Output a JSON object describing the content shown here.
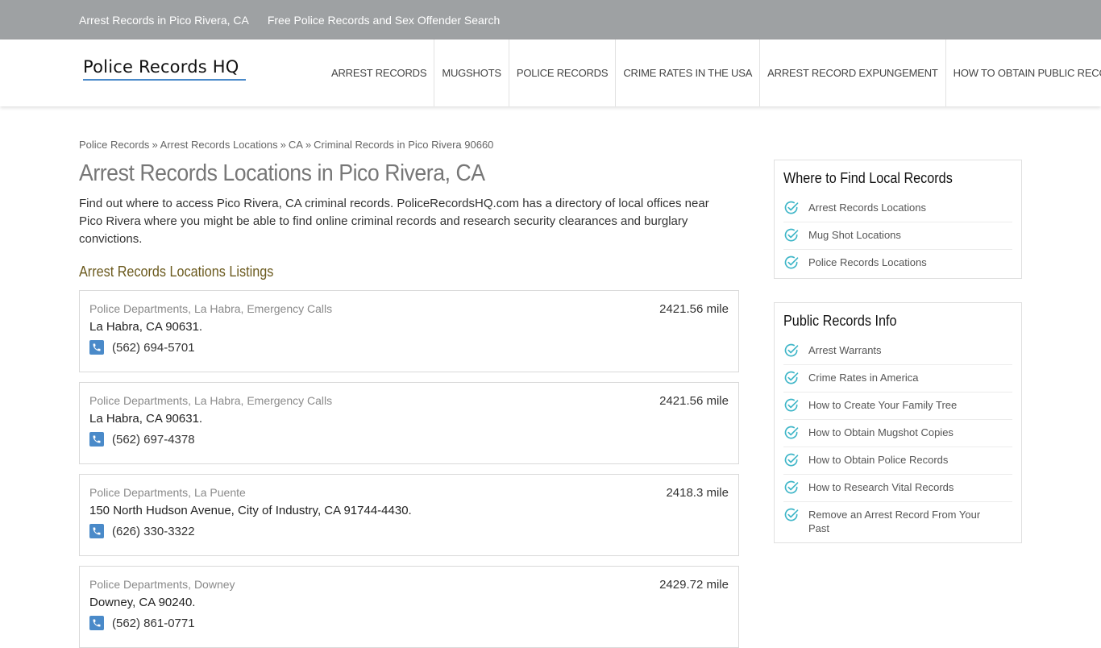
{
  "topbar": {
    "links": [
      "Arrest Records in Pico Rivera, CA",
      "Free Police Records and Sex Offender Search"
    ]
  },
  "header": {
    "logo": "Police Records HQ",
    "nav": [
      "Arrest Records",
      "Mugshots",
      "Police Records",
      "Crime Rates in the USA",
      "Arrest Record Expungement",
      "How to Obtain Public Records"
    ]
  },
  "breadcrumb": {
    "items": [
      "Police Records",
      "Arrest Records Locations",
      "CA",
      "Criminal Records in Pico Rivera 90660"
    ],
    "separator": "»"
  },
  "main": {
    "title": "Arrest Records Locations in Pico Rivera, CA",
    "intro": "Find out where to access Pico Rivera, CA criminal records. PoliceRecordsHQ.com has a directory of local offices near Pico Rivera where you might be able to find online criminal records and research security clearances and burglary convictions.",
    "listings_heading": "Arrest Records Locations Listings",
    "listings": [
      {
        "title": "Police Departments, La Habra, Emergency Calls",
        "distance": "2421.56 mile",
        "address": "La Habra, CA 90631.",
        "phone": "(562) 694-5701"
      },
      {
        "title": "Police Departments, La Habra, Emergency Calls",
        "distance": "2421.56 mile",
        "address": "La Habra, CA 90631.",
        "phone": "(562) 697-4378"
      },
      {
        "title": "Police Departments, La Puente",
        "distance": "2418.3 mile",
        "address": "150 North Hudson Avenue, City of Industry, CA 91744-4430.",
        "phone": "(626) 330-3322"
      },
      {
        "title": "Police Departments, Downey",
        "distance": "2429.72 mile",
        "address": "Downey, CA 90240.",
        "phone": "(562) 861-0771"
      }
    ]
  },
  "sidebar": {
    "widgets": [
      {
        "title": "Where to Find Local Records",
        "items": [
          "Arrest Records Locations",
          "Mug Shot Locations",
          "Police Records Locations"
        ]
      },
      {
        "title": "Public Records Info",
        "items": [
          "Arrest Warrants",
          "Crime Rates in America",
          "How to Create Your Family Tree",
          "How to Obtain Mugshot Copies",
          "How to Obtain Police Records",
          "How to Research Vital Records",
          "Remove an Arrest Record From Your Past"
        ]
      }
    ]
  },
  "colors": {
    "topbar": "#9ea1a3",
    "accent": "#4a8ac9",
    "heading_olive": "#6b5a1e",
    "check_teal": "#3fb6c8"
  },
  "icons": {
    "phone": "phone-icon",
    "check": "check-circle-icon"
  }
}
